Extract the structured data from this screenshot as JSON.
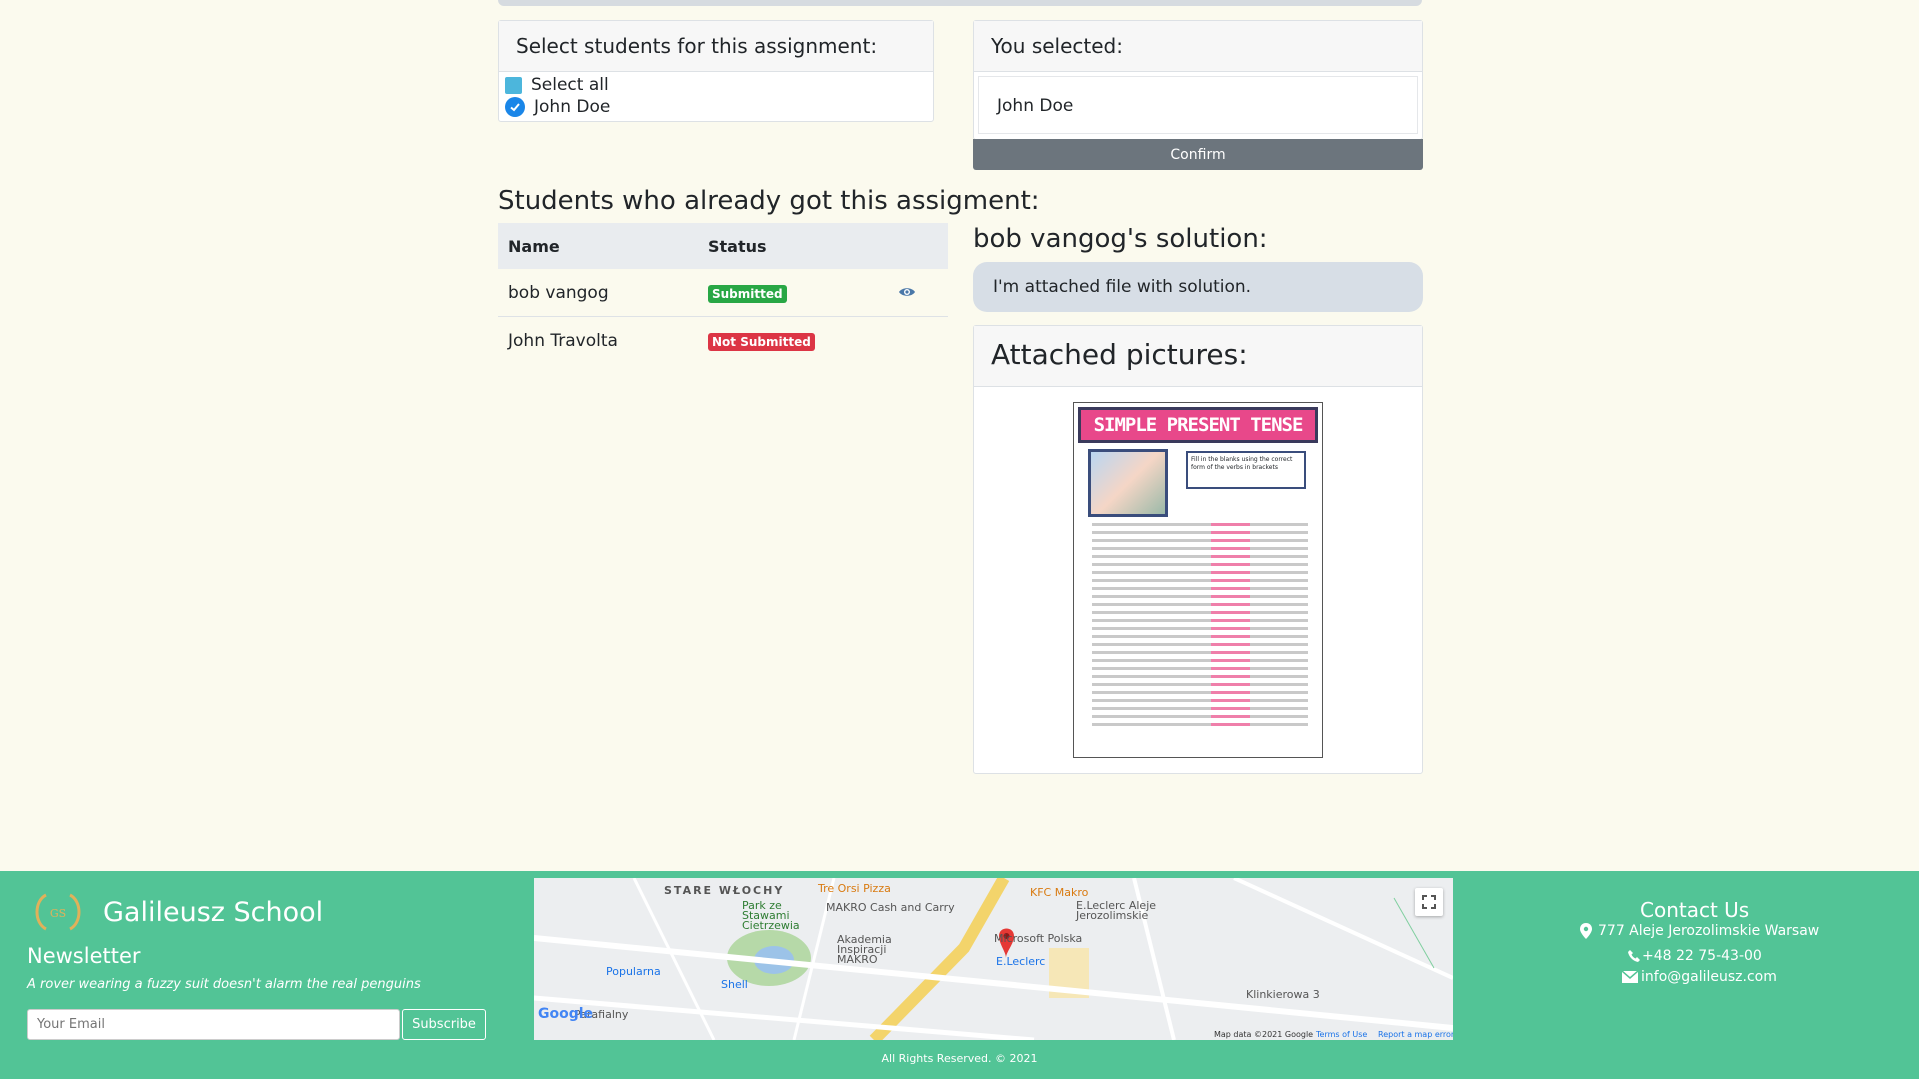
{
  "select_card": {
    "title": "Select students for this assignment:",
    "select_all_label": "Select all",
    "students": [
      "John Doe"
    ]
  },
  "selected_card": {
    "title": "You selected:",
    "selected_student": "John Doe",
    "confirm_label": "Confirm"
  },
  "already": {
    "title": "Students who already got this assigment:",
    "columns": [
      "Name",
      "Status"
    ],
    "rows": [
      {
        "name": "bob vangog",
        "status": "Submitted",
        "status_color": "#28a745",
        "action_icon": "eye-icon"
      },
      {
        "name": "John Travolta",
        "status": "Not Submitted",
        "status_color": "#dc3545"
      }
    ]
  },
  "solution": {
    "title": "bob vangog's solution:",
    "text": "I'm attached file with solution.",
    "pictures_title": "Attached pictures:",
    "worksheet_title": "SIMPLE PRESENT TENSE",
    "worksheet_instructions": "Fill in the blanks using the correct form of the verbs in brackets"
  },
  "footer": {
    "school_name": "Galileusz School",
    "logo_text": "GS",
    "newsletter_title": "Newsletter",
    "tagline": "A rover wearing a fuzzy suit doesn't alarm the real penguins",
    "email_placeholder": "Your Email",
    "subscribe_label": "Subscribe",
    "contact_title": "Contact Us",
    "address": "777 Aleje Jerozolimskie Warsaw",
    "phone": "+48 22 75-43-00",
    "email": "info@galileusz.com",
    "copyright": "All Rights Reserved. © 2021",
    "map": {
      "labels": [
        "STARE WŁOCHY",
        "Tre Orsi Pizza",
        "KFC Makro",
        "Park ze Stawami Cietrzewia",
        "MAKRO Cash and Carry",
        "E.Leclerc Aleje Jerozolimskie",
        "Akademia Inspiracji MAKRO",
        "Microsoft Polska",
        "E.Leclerc",
        "Popularna",
        "Shell",
        "Klinkierowa 3",
        "Parafialny"
      ],
      "footer_notes": [
        "Map data ©2021 Google",
        "Terms of Use",
        "Report a map error"
      ],
      "logo": "Google"
    }
  },
  "colors": {
    "page_bg": "#fbfaee",
    "footer_bg": "#52c496",
    "confirm_bg": "#6c757d"
  }
}
